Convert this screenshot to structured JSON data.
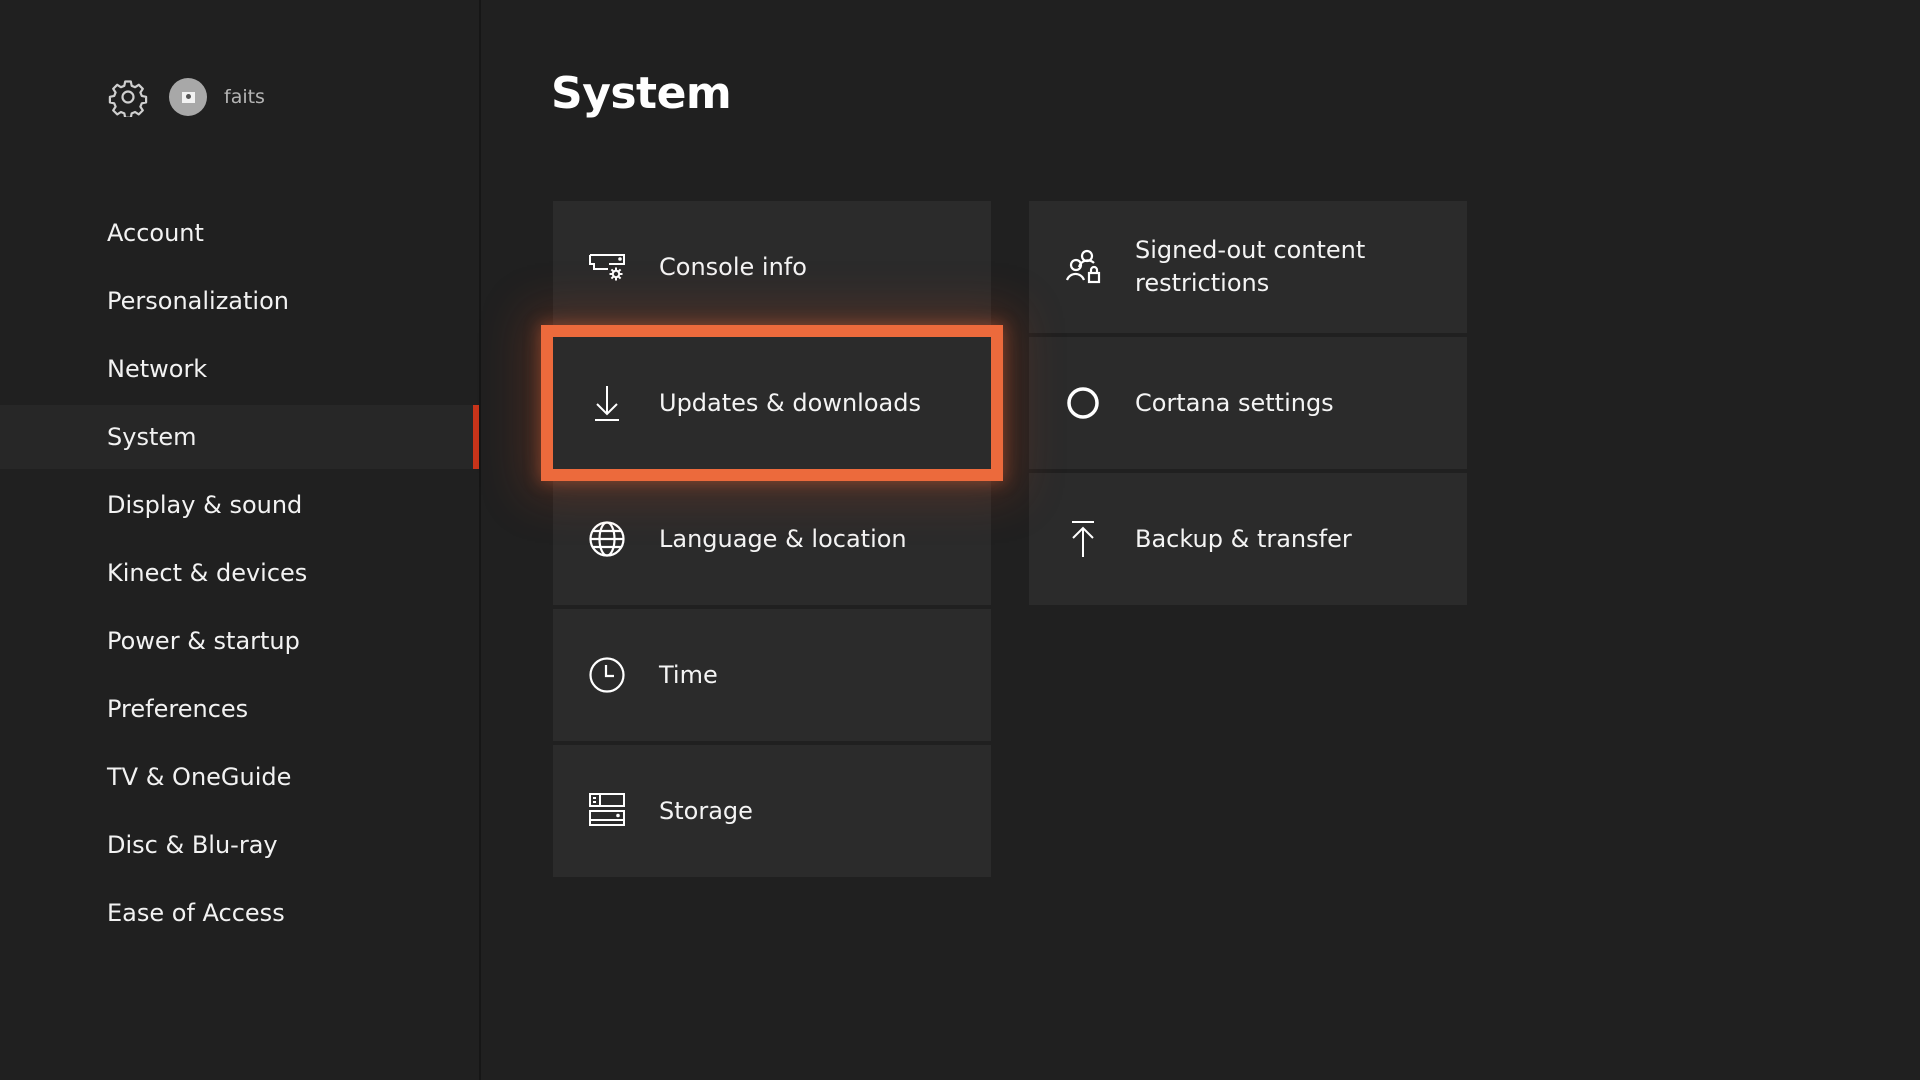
{
  "header": {
    "settings_icon": "gear-icon",
    "username": "faits"
  },
  "sidebar": {
    "selected_index": 3,
    "items": [
      {
        "label": "Account"
      },
      {
        "label": "Personalization"
      },
      {
        "label": "Network"
      },
      {
        "label": "System"
      },
      {
        "label": "Display & sound"
      },
      {
        "label": "Kinect & devices"
      },
      {
        "label": "Power & startup"
      },
      {
        "label": "Preferences"
      },
      {
        "label": "TV & OneGuide"
      },
      {
        "label": "Disc & Blu-ray"
      },
      {
        "label": "Ease of Access"
      }
    ]
  },
  "main": {
    "title": "System",
    "focused_tile": "Updates & downloads",
    "tiles": [
      {
        "label": "Console info",
        "icon": "console-info-icon"
      },
      {
        "label": "Updates & downloads",
        "icon": "download-icon"
      },
      {
        "label": "Language & location",
        "icon": "globe-icon"
      },
      {
        "label": "Time",
        "icon": "clock-icon"
      },
      {
        "label": "Storage",
        "icon": "storage-icon"
      },
      {
        "label": "Signed-out content restrictions",
        "icon": "people-lock-icon"
      },
      {
        "label": "Cortana settings",
        "icon": "cortana-icon"
      },
      {
        "label": "Backup & transfer",
        "icon": "upload-icon"
      }
    ]
  },
  "colors": {
    "background": "#202020",
    "tile": "#2b2b2b",
    "focus": "#ec6a3c",
    "selected_indicator": "#c8341a"
  }
}
